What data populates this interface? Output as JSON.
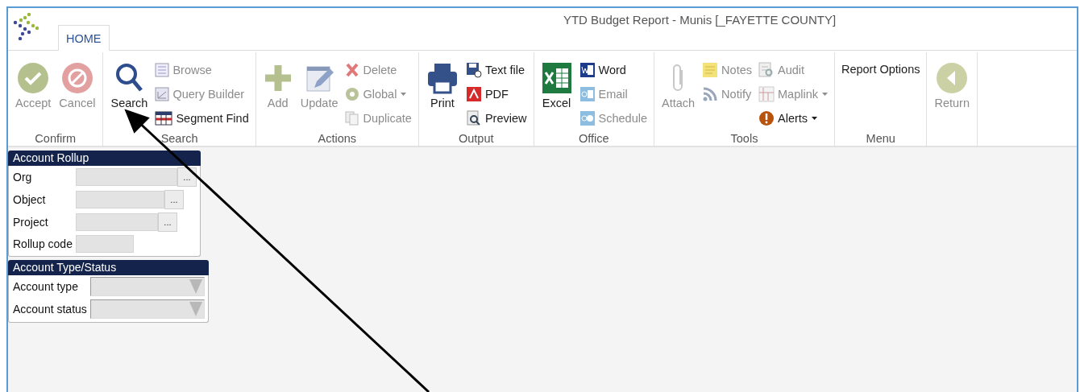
{
  "window": {
    "title": "YTD Budget Report - Munis [_FAYETTE COUNTY]"
  },
  "tabs": [
    {
      "label": "HOME",
      "selected": true
    }
  ],
  "ribbon": [
    {
      "label": "Confirm",
      "items": [
        {
          "label": "Accept",
          "kind": "large",
          "disabled": true
        },
        {
          "label": "Cancel",
          "kind": "large",
          "disabled": true
        }
      ]
    },
    {
      "label": "Search",
      "items": [
        {
          "label": "Search",
          "kind": "large",
          "disabled": false
        },
        {
          "label": "Browse",
          "kind": "small",
          "disabled": true
        },
        {
          "label": "Query Builder",
          "kind": "small",
          "disabled": true
        },
        {
          "label": "Segment Find",
          "kind": "small",
          "disabled": false
        }
      ]
    },
    {
      "label": "Actions",
      "items": [
        {
          "label": "Add",
          "kind": "large",
          "disabled": true
        },
        {
          "label": "Update",
          "kind": "large",
          "disabled": true
        },
        {
          "label": "Delete",
          "kind": "small",
          "disabled": true
        },
        {
          "label": "Global",
          "kind": "small",
          "disabled": true,
          "dropdown": true
        },
        {
          "label": "Duplicate",
          "kind": "small",
          "disabled": true
        }
      ]
    },
    {
      "label": "Output",
      "items": [
        {
          "label": "Print",
          "kind": "large",
          "disabled": false
        },
        {
          "label": "Text file",
          "kind": "small",
          "disabled": false
        },
        {
          "label": "PDF",
          "kind": "small",
          "disabled": false
        },
        {
          "label": "Preview",
          "kind": "small",
          "disabled": false
        }
      ]
    },
    {
      "label": "Office",
      "items": [
        {
          "label": "Excel",
          "kind": "large",
          "disabled": false
        },
        {
          "label": "Word",
          "kind": "small",
          "disabled": false
        },
        {
          "label": "Email",
          "kind": "small",
          "disabled": true
        },
        {
          "label": "Schedule",
          "kind": "small",
          "disabled": true
        }
      ]
    },
    {
      "label": "Tools",
      "items": [
        {
          "label": "Attach",
          "kind": "large",
          "disabled": true
        },
        {
          "label": "Notes",
          "kind": "small",
          "disabled": true
        },
        {
          "label": "Notify",
          "kind": "small",
          "disabled": true
        },
        {
          "label": "Audit",
          "kind": "small",
          "disabled": true
        },
        {
          "label": "Maplink",
          "kind": "small",
          "disabled": true,
          "dropdown": true
        },
        {
          "label": "Alerts",
          "kind": "small",
          "disabled": false,
          "dropdown": true
        }
      ]
    },
    {
      "label": "Menu",
      "items": [
        {
          "label": "Report Options",
          "kind": "text",
          "disabled": false
        }
      ]
    },
    {
      "items": [
        {
          "label": "Return",
          "kind": "large",
          "disabled": true
        }
      ]
    }
  ],
  "panels": [
    {
      "title": "Account Rollup",
      "fields": [
        {
          "label": "Org",
          "kind": "lookup",
          "button": "..."
        },
        {
          "label": "Object",
          "kind": "lookup",
          "button": "..."
        },
        {
          "label": "Project",
          "kind": "lookup",
          "button": "..."
        },
        {
          "label": "Rollup code",
          "kind": "text"
        }
      ]
    },
    {
      "title": "Account Type/Status",
      "fields": [
        {
          "label": "Account type",
          "kind": "select"
        },
        {
          "label": "Account status",
          "kind": "select"
        }
      ]
    }
  ]
}
